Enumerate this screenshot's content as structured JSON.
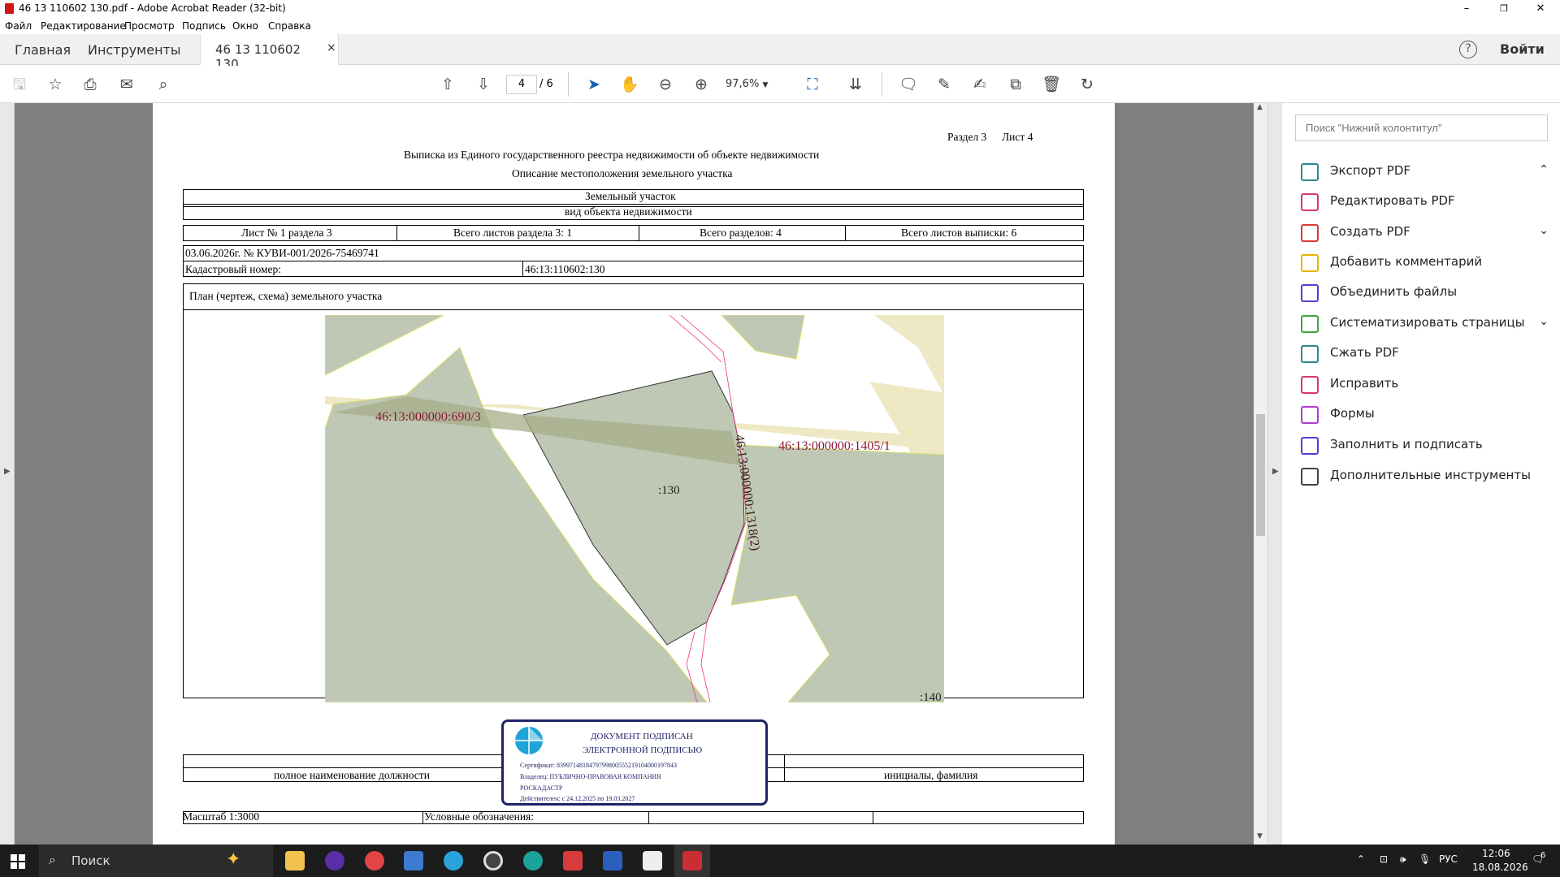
{
  "window": {
    "title": "46 13 110602 130.pdf - Adobe Acrobat Reader (32-bit)",
    "min": "–",
    "max": "❐",
    "close": "✕"
  },
  "menu": [
    "Файл",
    "Редактирование",
    "Просмотр",
    "Подпись",
    "Окно",
    "Справка"
  ],
  "tabs": {
    "home": "Главная",
    "tools": "Инструменты",
    "doc": "46 13 110602 130....",
    "close": "×",
    "help": "?",
    "login": "Войти"
  },
  "toolbar": {
    "page": "4",
    "total": "/ 6",
    "zoom": "97,6%"
  },
  "doc": {
    "section": "Раздел 3",
    "sheet": "Лист 4",
    "title": "Выписка из Единого государственного реестра недвижимости об объекте недвижимости",
    "subtitle": "Описание местоположения земельного участка",
    "object": "Земельный участок",
    "object_kind": "вид объекта недвижимости",
    "row_cells": [
      "Лист № 1 раздела 3",
      "Всего листов раздела 3: 1",
      "Всего разделов: 4",
      "Всего листов выписки: 6"
    ],
    "date_no": "03.06.2026г. № КУВИ-001/2026-75469741",
    "cad_label": "Кадастровый номер:",
    "cad_value": "46:13:110602:130",
    "plan_title": "План (чертеж, схема) земельного участка",
    "map_labels": {
      "a": "46:13:000000:690/3",
      "b": "46:13:000000:1405/1",
      "c": ":130",
      "d": "46:13:000000:1318(2)",
      "e": ":140"
    },
    "scale": "Масштаб 1:3000",
    "legend": "Условные обозначения:",
    "position_label": "полное наименование должности",
    "initials_label": "инициалы, фамилия"
  },
  "stamp": {
    "l1": "ДОКУМЕНТ ПОДПИСАН",
    "l2": "ЭЛЕКТРОННОЙ ПОДПИСЬЮ",
    "cert": "Сертификат: 839971481847979980055521910400019784З",
    "owner": "Владелец: ПУБЛИЧНО-ПРАВОВАЯ КОМПАНИЯ",
    "owner2": "РОСКАДАСТР",
    "valid": "Действителен: с 24.12.2025 по 19.03.2027"
  },
  "right_panel": {
    "search_placeholder": "Поиск \"Нижний колонтитул\"",
    "items": [
      {
        "label": "Экспорт PDF",
        "icon": "export-pdf-icon",
        "color": "#2b8a8a",
        "chevron": "⌃"
      },
      {
        "label": "Редактировать PDF",
        "icon": "edit-pdf-icon",
        "color": "#d63a6a",
        "chevron": ""
      },
      {
        "label": "Создать PDF",
        "icon": "create-pdf-icon",
        "color": "#d63a3a",
        "chevron": "⌄"
      },
      {
        "label": "Добавить комментарий",
        "icon": "comment-icon",
        "color": "#e8b400",
        "chevron": ""
      },
      {
        "label": "Объединить файлы",
        "icon": "combine-icon",
        "color": "#5a3ad6",
        "chevron": ""
      },
      {
        "label": "Систематизировать страницы",
        "icon": "organize-icon",
        "color": "#3aa83a",
        "chevron": "⌄"
      },
      {
        "label": "Сжать PDF",
        "icon": "compress-icon",
        "color": "#2b8a8a",
        "chevron": ""
      },
      {
        "label": "Исправить",
        "icon": "fix-icon",
        "color": "#d63a6a",
        "chevron": ""
      },
      {
        "label": "Формы",
        "icon": "forms-icon",
        "color": "#b03ad6",
        "chevron": ""
      },
      {
        "label": "Заполнить и подписать",
        "icon": "fill-sign-icon",
        "color": "#5a3ad6",
        "chevron": ""
      },
      {
        "label": "Дополнительные инструменты",
        "icon": "more-tools-icon",
        "color": "#444",
        "chevron": ""
      }
    ]
  },
  "taskbar": {
    "search": "Поиск",
    "lang": "РУС",
    "time": "12:06",
    "date": "18.08.2026",
    "notif": "6"
  }
}
